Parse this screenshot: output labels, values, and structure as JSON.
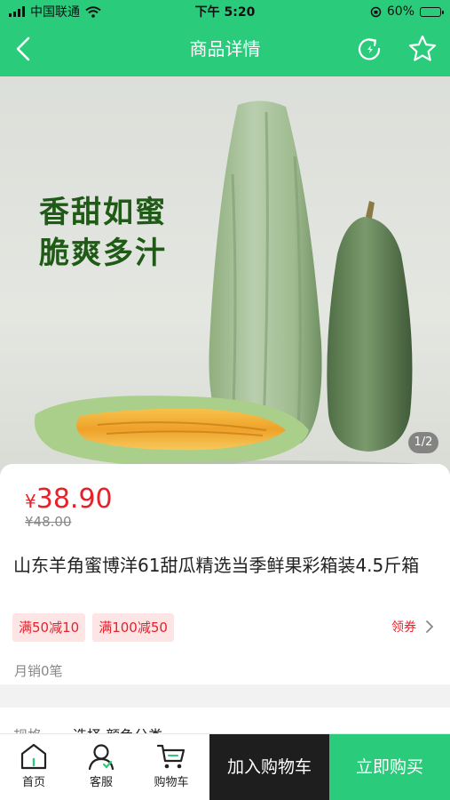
{
  "status_bar": {
    "carrier": "中国联通",
    "time": "下午 5:20",
    "battery": "60%",
    "battery_level": 0.6
  },
  "nav": {
    "title": "商品详情",
    "back_icon": "chevron-left-icon",
    "refresh_icon": "refresh-icon",
    "favorite_icon": "star-icon"
  },
  "hero": {
    "slogan_line1": "香甜如蜜",
    "slogan_line2": "脆爽多汁",
    "page_indicator": "1/2"
  },
  "product": {
    "currency": "¥",
    "price": "38.90",
    "original_price": "¥48.00",
    "title": "山东羊角蜜博洋61甜瓜精选当季鲜果彩箱装4.5斤箱",
    "coupons": [
      "满50减10",
      "满100减50"
    ],
    "get_coupon_label": "领券",
    "monthly_sales": "月销0笔"
  },
  "spec": {
    "label": "规格",
    "value": "选择 颜色分类"
  },
  "bottom_bar": {
    "tabs": [
      {
        "label": "首页",
        "icon": "home-icon"
      },
      {
        "label": "客服",
        "icon": "customer-service-icon"
      },
      {
        "label": "购物车",
        "icon": "cart-icon"
      }
    ],
    "add_to_cart": "加入购物车",
    "buy_now": "立即购买"
  },
  "colors": {
    "accent": "#2bcb7c",
    "price_red": "#e8202a",
    "dark_button": "#1e1e1e"
  }
}
